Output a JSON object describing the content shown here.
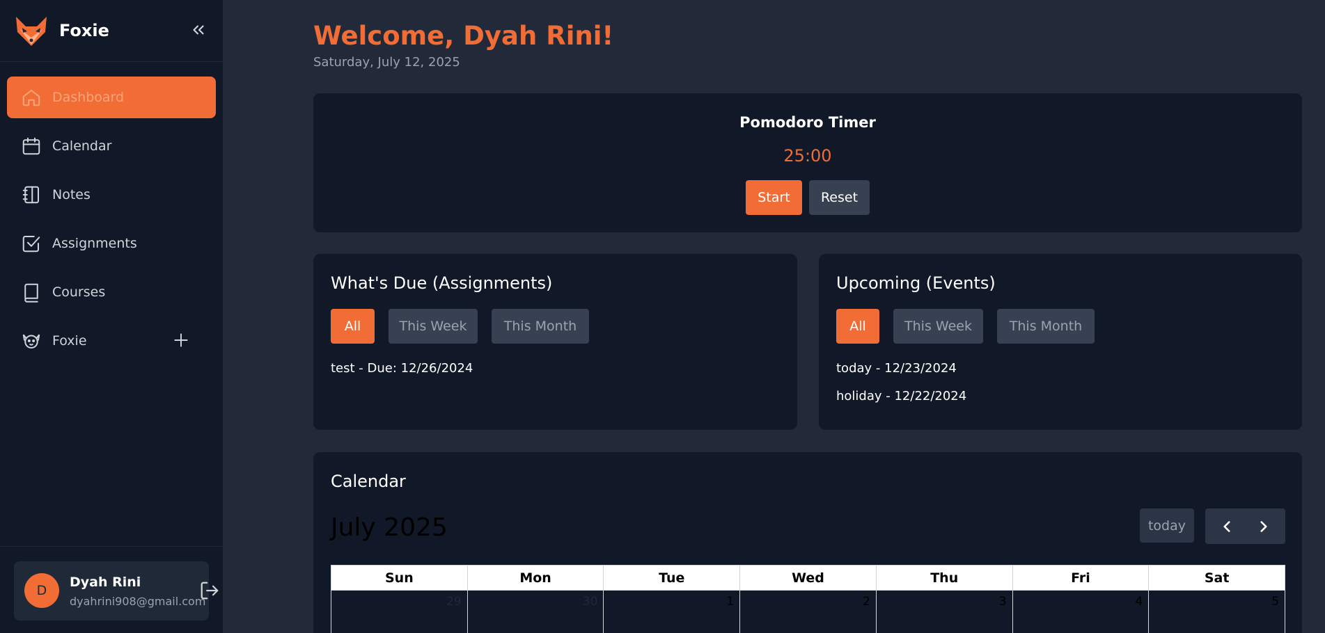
{
  "app": {
    "brand": "Foxie"
  },
  "sidebar": {
    "items": [
      {
        "label": "Dashboard",
        "icon": "home-icon"
      },
      {
        "label": "Calendar",
        "icon": "calendar-icon"
      },
      {
        "label": "Notes",
        "icon": "notebook-icon"
      },
      {
        "label": "Assignments",
        "icon": "checkbox-icon"
      },
      {
        "label": "Courses",
        "icon": "book-icon"
      },
      {
        "label": "Foxie",
        "icon": "pet-icon"
      }
    ]
  },
  "user": {
    "initial": "D",
    "name": "Dyah Rini",
    "email": "dyahrini908@gmail.com"
  },
  "header": {
    "welcome": "Welcome, Dyah Rini!",
    "date": "Saturday, July 12, 2025"
  },
  "pomodoro": {
    "title": "Pomodoro Timer",
    "time": "25:00",
    "start_label": "Start",
    "reset_label": "Reset"
  },
  "due": {
    "title": "What's Due (Assignments)",
    "filters": [
      "All",
      "This Week",
      "This Month"
    ],
    "items": [
      "test - Due: 12/26/2024"
    ]
  },
  "upcoming": {
    "title": "Upcoming (Events)",
    "filters": [
      "All",
      "This Week",
      "This Month"
    ],
    "items": [
      "today - 12/23/2024",
      "holiday - 12/22/2024"
    ]
  },
  "calendar": {
    "title": "Calendar",
    "month": "July 2025",
    "today_label": "today",
    "days": [
      "Sun",
      "Mon",
      "Tue",
      "Wed",
      "Thu",
      "Fri",
      "Sat"
    ],
    "first_row": [
      "29",
      "30",
      "1",
      "2",
      "3",
      "4",
      "5"
    ]
  },
  "colors": {
    "accent": "#f26d36",
    "sidebar_bg": "#111827",
    "page_bg": "#222938",
    "card_bg": "#111827"
  }
}
